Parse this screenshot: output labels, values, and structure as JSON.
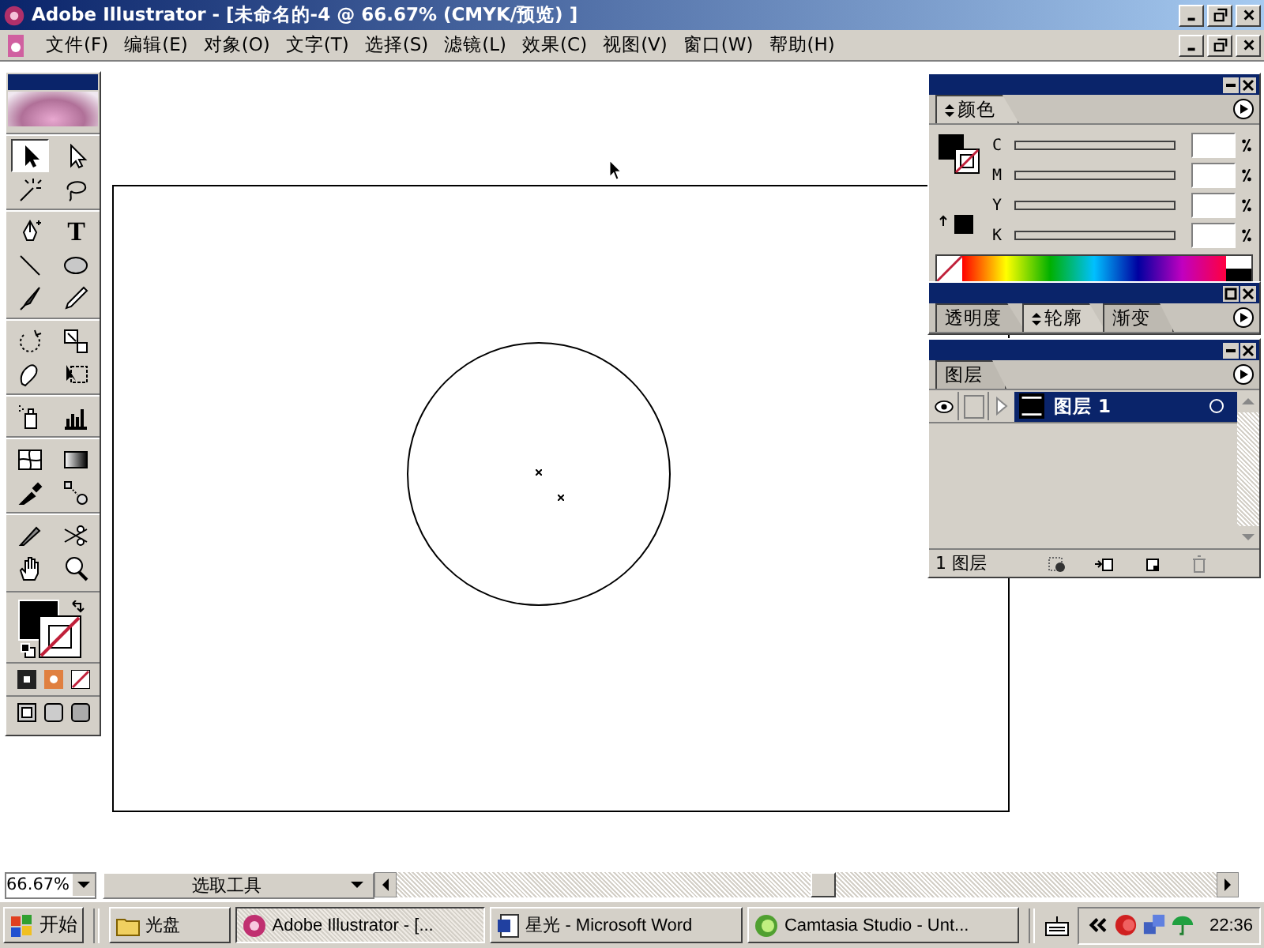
{
  "window": {
    "title": "Adobe Illustrator - [未命名的-4 @ 66.67% (CMYK/预览) ]"
  },
  "menu": [
    "文件(F)",
    "编辑(E)",
    "对象(O)",
    "文字(T)",
    "选择(S)",
    "滤镜(L)",
    "效果(C)",
    "视图(V)",
    "窗口(W)",
    "帮助(H)"
  ],
  "toolbox": {
    "groups": [
      [
        {
          "kind": "selection",
          "selected": true
        },
        {
          "kind": "direct-selection",
          "selected": false
        },
        {
          "kind": "magic-wand",
          "selected": false
        },
        {
          "kind": "lasso",
          "selected": false
        }
      ],
      [
        {
          "kind": "pen",
          "selected": false
        },
        {
          "kind": "type",
          "glyph": "T",
          "selected": false
        },
        {
          "kind": "line",
          "selected": false
        },
        {
          "kind": "ellipse",
          "selected": false
        },
        {
          "kind": "brush",
          "selected": false
        },
        {
          "kind": "pencil",
          "selected": false
        }
      ],
      [
        {
          "kind": "rotate",
          "selected": false
        },
        {
          "kind": "scale",
          "selected": false
        },
        {
          "kind": "warp",
          "selected": false
        },
        {
          "kind": "free-transform",
          "selected": false
        }
      ],
      [
        {
          "kind": "spray",
          "selected": false
        },
        {
          "kind": "graph",
          "selected": false
        }
      ],
      [
        {
          "kind": "mesh",
          "selected": false
        },
        {
          "kind": "gradient",
          "selected": false
        },
        {
          "kind": "eyedropper",
          "selected": false
        },
        {
          "kind": "blend",
          "selected": false
        }
      ],
      [
        {
          "kind": "knife",
          "selected": false
        },
        {
          "kind": "scissors",
          "selected": false
        },
        {
          "kind": "hand",
          "selected": false
        },
        {
          "kind": "zoom",
          "selected": false
        }
      ]
    ]
  },
  "color_panel": {
    "tab": {
      "label": "颜色",
      "selected": true
    },
    "channels": [
      {
        "label": "C"
      },
      {
        "label": "M"
      },
      {
        "label": "Y"
      },
      {
        "label": "K"
      }
    ]
  },
  "appearance_panel": {
    "tabs": [
      {
        "label": "透明度",
        "selected": false
      },
      {
        "label": "轮廓",
        "selected": true
      },
      {
        "label": "渐变",
        "selected": false
      }
    ]
  },
  "layers_panel": {
    "tab": {
      "label": "图层",
      "selected": false
    },
    "layers": [
      {
        "name": "图层 1",
        "selected": true,
        "visible": true
      }
    ],
    "count": "1 图层"
  },
  "status_bar": {
    "zoom": "66.67%",
    "tool": "选取工具"
  },
  "taskbar": {
    "start": "开始",
    "tasks": [
      {
        "kind": "folder",
        "label": "光盘",
        "selected": false
      },
      {
        "kind": "illustrator",
        "label": "Adobe Illustrator - [...",
        "selected": true
      },
      {
        "kind": "word",
        "label": "星光 - Microsoft Word",
        "selected": false
      },
      {
        "kind": "camtasia",
        "label": "Camtasia Studio - Unt...",
        "selected": false
      }
    ],
    "clock": "22:36"
  }
}
